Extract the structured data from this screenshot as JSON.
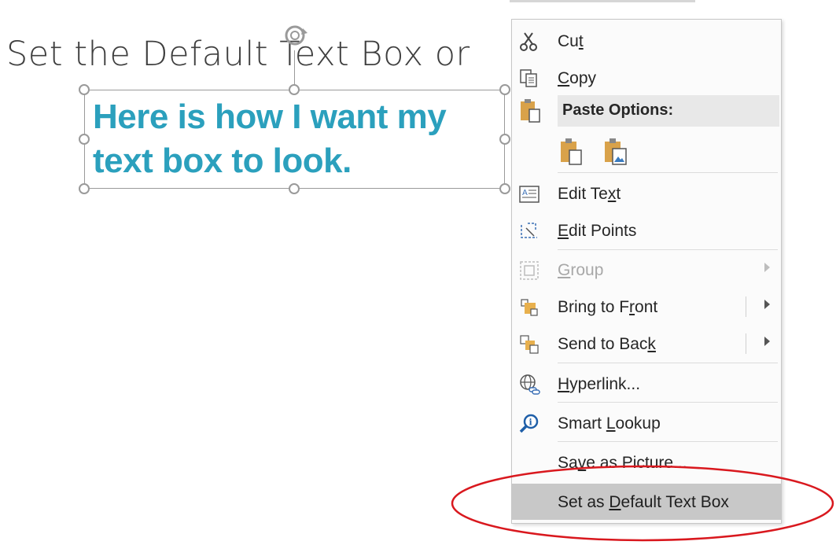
{
  "slide": {
    "title": "Set the Default Text Box or",
    "textbox_line1": "Here is how I want my",
    "textbox_line2": "text box to look."
  },
  "context_menu": {
    "cut": {
      "pre": "Cu",
      "key": "t",
      "post": ""
    },
    "copy": {
      "pre": "",
      "key": "C",
      "post": "opy"
    },
    "paste_options": "Paste Options:",
    "edit_text": {
      "pre": "Edit Te",
      "key": "x",
      "post": "t"
    },
    "edit_points": {
      "pre": "",
      "key": "E",
      "post": "dit Points"
    },
    "group": {
      "pre": "",
      "key": "G",
      "post": "roup"
    },
    "bring_to_front": {
      "pre": "Bring to F",
      "key": "r",
      "post": "ont"
    },
    "send_to_back": {
      "pre": "Send to Bac",
      "key": "k",
      "post": ""
    },
    "hyperlink": {
      "pre": "",
      "key": "H",
      "post": "yperlink..."
    },
    "smart_lookup": {
      "pre": "Smart ",
      "key": "L",
      "post": "ookup"
    },
    "save_as_picture": {
      "pre": "Sa",
      "key": "v",
      "post": "e as Picture..."
    },
    "set_default": {
      "pre": "Set as ",
      "key": "D",
      "post": "efault Text Box"
    }
  },
  "colors": {
    "textbox_text": "#2ba0bd",
    "annotation_oval": "#d9181e",
    "highlight": "#c8c8c8"
  },
  "icons": [
    "scissors-icon",
    "copy-icon",
    "paste-icon",
    "paste-keep-format-icon",
    "paste-picture-icon",
    "edit-text-icon",
    "edit-points-icon",
    "group-icon",
    "bring-to-front-icon",
    "send-to-back-icon",
    "hyperlink-icon",
    "smart-lookup-icon"
  ]
}
